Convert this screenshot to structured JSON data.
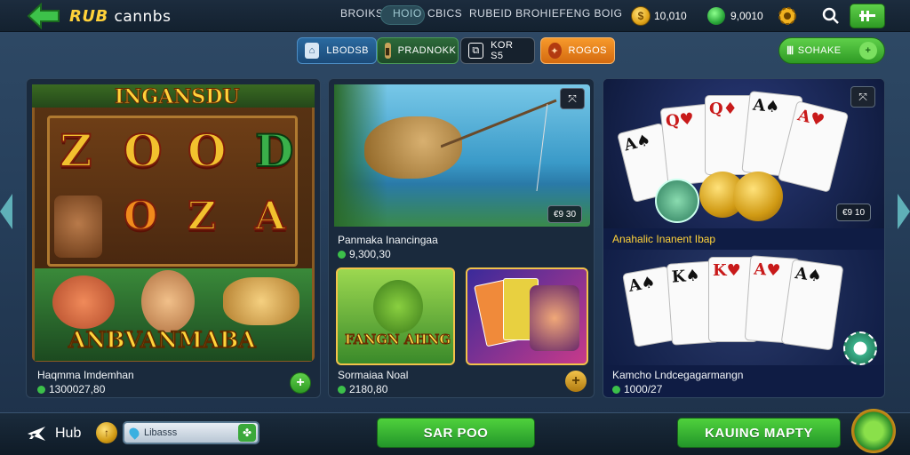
{
  "header": {
    "logo_part1": "RUB",
    "logo_part2": "cannbs",
    "nav": [
      "BROIKS",
      "HOIO",
      "CBICS",
      "RUBEID BROH",
      "IEFENG BOIG"
    ],
    "coins_value": "10,010",
    "gems_value": "9,0010"
  },
  "filters": [
    {
      "label": "LBODSB",
      "icon": "home-icon"
    },
    {
      "label": "PRADNOKK",
      "icon": "bottle-icon"
    },
    {
      "label": "KOR S5",
      "icon": "ticket-icon"
    },
    {
      "label": "ROGOS",
      "icon": "gift-icon"
    }
  ],
  "add_button_label": "SOHAKE",
  "cards": {
    "slot": {
      "banner_top": "INGANSDU",
      "symbols_row1": [
        "Z",
        "O",
        "O",
        "D"
      ],
      "symbols_row2": [
        "O",
        "Z",
        "A"
      ],
      "banner_bottom": "ANBVANMABA",
      "title": "Haqmma Imdemhan",
      "price": "1300027,80"
    },
    "fish": {
      "tag": "€9 30",
      "title": "Panmaka Inancingaa",
      "price": "9,300,30"
    },
    "frog": {
      "banner": "FANGN AHNG",
      "title": "Sormaiaa Noal",
      "price": "2180,80"
    },
    "poker_top": {
      "tag": "€9 10",
      "title": "Anahalic Inanent Ibap"
    },
    "poker_bottom": {
      "title": "Kamcho Lndcegagarmangn",
      "price": "1000/27"
    }
  },
  "footer": {
    "hub_label": "Hub",
    "search_placeholder": "Libasss",
    "button_left": "SAR POO",
    "button_right": "KAUING MAPTY"
  },
  "colors": {
    "accent_green": "#3cb93a",
    "orange": "#f08a1c",
    "gold": "#ffd23a",
    "card_bg": "#1a2a3d"
  }
}
